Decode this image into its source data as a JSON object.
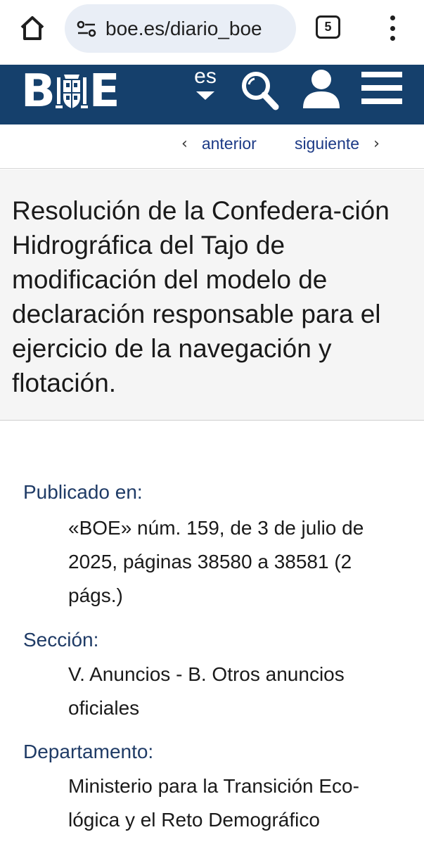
{
  "browser": {
    "url": "boe.es/diario_boe",
    "tab_count": "5"
  },
  "header": {
    "logo_text": "BOE",
    "language": "es",
    "colors": {
      "brand": "#15406c"
    }
  },
  "pager": {
    "prev_label": "anterior",
    "next_label": "siguiente"
  },
  "document": {
    "title": "Resolución de la Confedera-ción Hidrográfica del Tajo de modificación del modelo de declaración responsable para el ejercicio de la navegación y flotación."
  },
  "meta": {
    "published_label": "Publicado en:",
    "published_value": "«BOE» núm. 159, de 3 de julio de 2025, páginas 38580 a 38581 (2 págs.)",
    "section_label": "Sección:",
    "section_value": "V. Anuncios - B. Otros anuncios oficiales",
    "department_label": "Departamento:",
    "department_value": "Ministerio para la Transición Eco-lógica y el Reto Demográfico"
  },
  "icons": {
    "home": "home-icon",
    "site_info": "tune-icon",
    "tabs": "tabs-icon",
    "menu": "more-vert-icon",
    "search": "search-icon",
    "user": "user-icon",
    "hamburger": "hamburger-icon"
  }
}
